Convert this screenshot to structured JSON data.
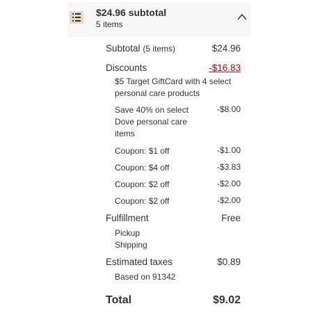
{
  "header": {
    "title": "$24.96 subtotal",
    "subtitle": "5 items",
    "icons": {
      "left": "receipt-list-icon",
      "right": "chevron-up-icon"
    },
    "expanded": true
  },
  "subtotal": {
    "label": "Subtotal",
    "count": "(5 items)",
    "amount": "$24.96"
  },
  "discounts": {
    "label": "Discounts",
    "amount": "-$16.83",
    "color": "#cc0000",
    "items": [
      {
        "line1": "$5 Target GiftCard with 4 select",
        "line2": "personal care products",
        "amount": ""
      },
      {
        "line1": "Save 40% on select",
        "line2": "Dove personal care",
        "line3": "items",
        "amount": "-$8.00"
      },
      {
        "label": "Coupon: $1 off",
        "amount": "-$1.00"
      },
      {
        "label": "Coupon: $4 off",
        "amount": "-$3.83"
      },
      {
        "label": "Coupon: $2 off",
        "amount": "-$2.00"
      },
      {
        "label": "Coupon: $2 off",
        "amount": "-$2.00"
      }
    ]
  },
  "fulfillment": {
    "label": "Fulfillment",
    "amount": "Free",
    "methods": [
      "Pickup",
      "Shipping"
    ]
  },
  "taxes": {
    "label": "Estimated taxes",
    "amount": "$0.89",
    "note": "Based on 91342"
  },
  "total": {
    "label": "Total",
    "amount": "$9.02"
  }
}
